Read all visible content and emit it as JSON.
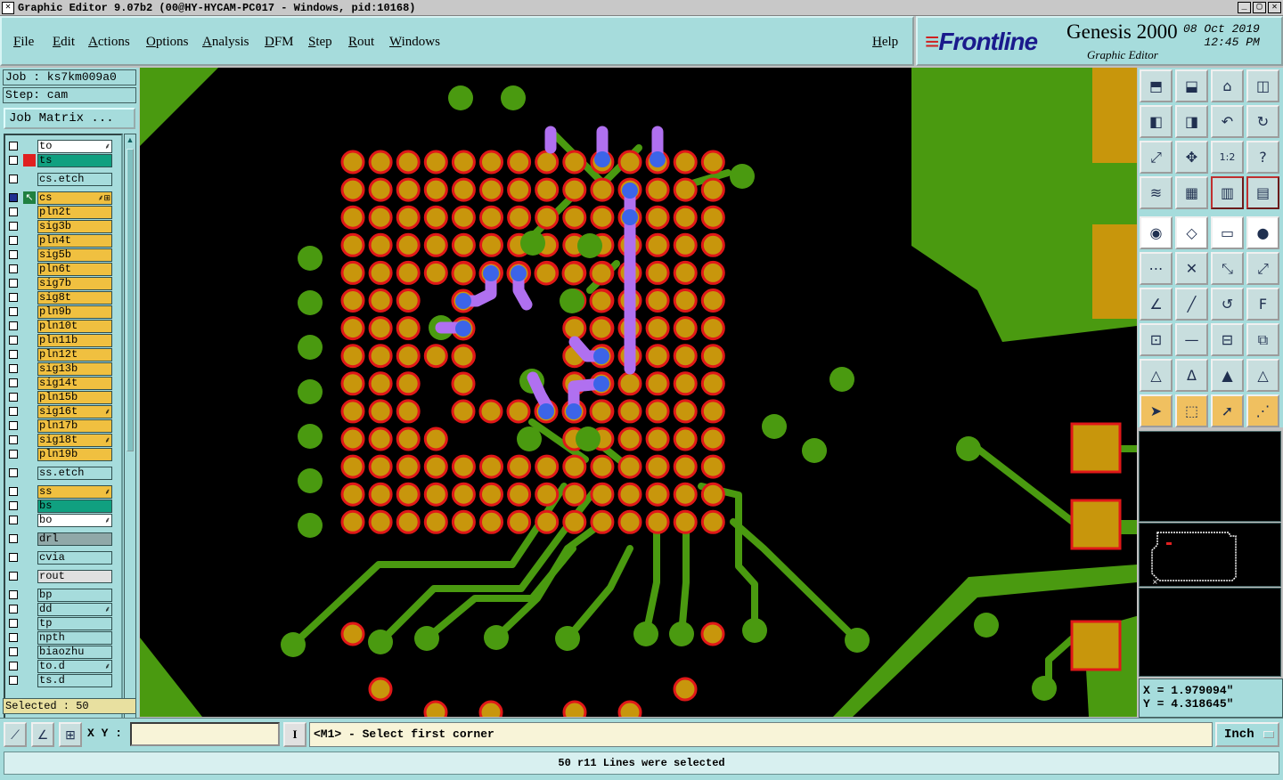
{
  "window": {
    "title": "Graphic Editor 9.07b2 (00@HY-HYCAM-PC017 - Windows, pid:10168)",
    "controls": [
      "_",
      "▢",
      "✕"
    ]
  },
  "menu": {
    "items": [
      {
        "label": "File"
      },
      {
        "label": "Edit"
      },
      {
        "label": "Actions"
      },
      {
        "label": "Options"
      },
      {
        "label": "Analysis"
      },
      {
        "label": "DFM"
      },
      {
        "label": "Step"
      },
      {
        "label": "Rout"
      },
      {
        "label": "Windows"
      }
    ],
    "help": "Help"
  },
  "brand": {
    "logo_a": "Front",
    "logo_b": "line",
    "product": "Genesis 2000",
    "subtitle": "Graphic Editor",
    "date": "08 Oct 2019",
    "time": "12:45 PM"
  },
  "job": {
    "job_label": "Job : ks7km009a0",
    "step_label": "Step: cam",
    "matrix_button": "Job Matrix ..."
  },
  "layers": [
    {
      "name": "to",
      "color": "#ffffff",
      "flag": "⸙"
    },
    {
      "name": "ts",
      "color": "#10a080",
      "mark": "#e02020"
    },
    {
      "name": "cs.etch",
      "color": "#a6dcdc",
      "gap": true
    },
    {
      "name": "cs",
      "color": "#f0c040",
      "active": true,
      "flag": "⸙⊞",
      "gap": true
    },
    {
      "name": "pln2t",
      "color": "#f0c040"
    },
    {
      "name": "sig3b",
      "color": "#f0c040"
    },
    {
      "name": "pln4t",
      "color": "#f0c040"
    },
    {
      "name": "sig5b",
      "color": "#f0c040"
    },
    {
      "name": "pln6t",
      "color": "#f0c040"
    },
    {
      "name": "sig7b",
      "color": "#f0c040"
    },
    {
      "name": "sig8t",
      "color": "#f0c040"
    },
    {
      "name": "pln9b",
      "color": "#f0c040"
    },
    {
      "name": "pln10t",
      "color": "#f0c040"
    },
    {
      "name": "pln11b",
      "color": "#f0c040"
    },
    {
      "name": "pln12t",
      "color": "#f0c040"
    },
    {
      "name": "sig13b",
      "color": "#f0c040"
    },
    {
      "name": "sig14t",
      "color": "#f0c040"
    },
    {
      "name": "pln15b",
      "color": "#f0c040"
    },
    {
      "name": "sig16t",
      "color": "#f0c040",
      "flag": "⸙"
    },
    {
      "name": "pln17b",
      "color": "#f0c040"
    },
    {
      "name": "sig18t",
      "color": "#f0c040",
      "flag": "⸙"
    },
    {
      "name": "pln19b",
      "color": "#f0c040"
    },
    {
      "name": "ss.etch",
      "color": "#a6dcdc",
      "gap": true
    },
    {
      "name": "ss",
      "color": "#f0c040",
      "flag": "⸙",
      "gap": true
    },
    {
      "name": "bs",
      "color": "#10a080"
    },
    {
      "name": "bo",
      "color": "#ffffff",
      "flag": "⸙"
    },
    {
      "name": "drl",
      "color": "#90a8a8",
      "gap": true
    },
    {
      "name": "cvia",
      "color": "#a6dcdc",
      "gap": true
    },
    {
      "name": "rout",
      "color": "#e0e0e0",
      "gap": true
    },
    {
      "name": "bp",
      "color": "#a6dcdc",
      "gap": true
    },
    {
      "name": "dd",
      "color": "#a6dcdc",
      "flag": "⸙"
    },
    {
      "name": "tp",
      "color": "#a6dcdc"
    },
    {
      "name": "npth",
      "color": "#a6dcdc"
    },
    {
      "name": "biaozhu",
      "color": "#a6dcdc"
    },
    {
      "name": "to.d",
      "color": "#a6dcdc",
      "flag": "⸙"
    },
    {
      "name": "ts.d",
      "color": "#a6dcdc"
    }
  ],
  "selected_count": "Selected : 50",
  "colors": {
    "panel": "#a6dcdc",
    "copper": "#4a9a10",
    "pad_fill": "#c8960c",
    "pad_ring": "#e01818",
    "selection": "#b070f0",
    "via_highlight": "#3c64e8"
  },
  "tools": [
    "top-view-icon",
    "bottom-view-icon",
    "home-icon",
    "window-icon",
    "pan-left-icon",
    "pan-right-icon",
    "undo-view-icon",
    "redraw-icon",
    "zoom-fit-icon",
    "zoom-extents-icon",
    "scale-1-2-icon",
    "help-icon",
    "snap-icon",
    "grid-icon",
    "layers-compare-icon",
    "layers-swap-icon",
    "fill-mode-icon",
    "outline-mode-icon",
    "measure-ruler-icon",
    "pad-icon",
    "connect-icon",
    "cross-icon",
    "line-to-icon",
    "line-from-icon",
    "angle-icon",
    "slash-icon",
    "arc-icon",
    "text-f-icon",
    "node-icon",
    "line-icon",
    "fit-box-icon",
    "shapes-icon",
    "triangle-icon",
    "triangle-a-icon",
    "triangle-b-icon",
    "triangle-c-icon",
    "select-arrow-icon",
    "select-box-icon",
    "select-touch-icon",
    "select-net-icon"
  ],
  "coords": {
    "x": "X = 1.979094\"",
    "y": "Y = 4.318645\""
  },
  "bottom": {
    "xy_label": "X Y :",
    "xy_value": "",
    "info_glyph": "I",
    "prompt": "<M1> - Select first corner",
    "units": "Inch"
  },
  "status": "50 r11 Lines were selected"
}
